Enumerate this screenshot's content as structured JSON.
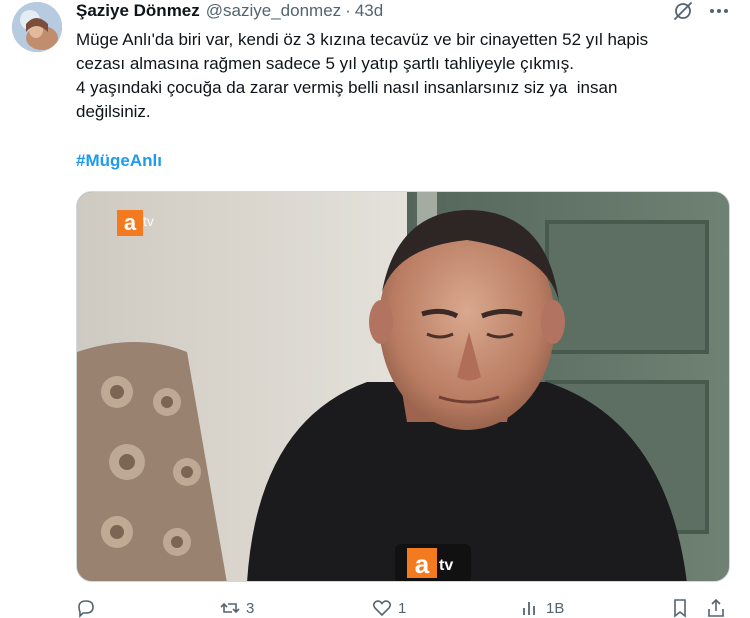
{
  "tweet": {
    "author": {
      "display_name": "Şaziye Dönmez",
      "handle": "@saziye_donmez",
      "separator": "·",
      "time": "43d"
    },
    "text_lines": [
      "Müge Anlı'da biri var, kendi öz 3 kızına tecavüz ve bir cinayetten 52 yıl hapis",
      "cezası almasına rağmen sadece 5 yıl yatıp şartlı tahliyeyle çıkmış.",
      "4 yaşındaki çocuğa da zarar vermiş belli nasıl insanlarsınız siz ya  insan",
      "değilsiniz."
    ],
    "hashtag": "#MügeAnlı",
    "media": {
      "watermark": "atv",
      "mic_logo": "atv"
    },
    "actions": {
      "reply_count": "",
      "retweet_count": "3",
      "like_count": "1",
      "views_count": "1B"
    },
    "icons": {
      "grok": "grok-icon",
      "more": "more-icon",
      "reply": "reply-icon",
      "retweet": "retweet-icon",
      "like": "heart-icon",
      "views": "views-icon",
      "bookmark": "bookmark-icon",
      "share": "share-icon"
    },
    "colors": {
      "text": "#0f1419",
      "secondary": "#536471",
      "link": "#1d9bf0",
      "atv_orange": "#f47a20"
    }
  }
}
